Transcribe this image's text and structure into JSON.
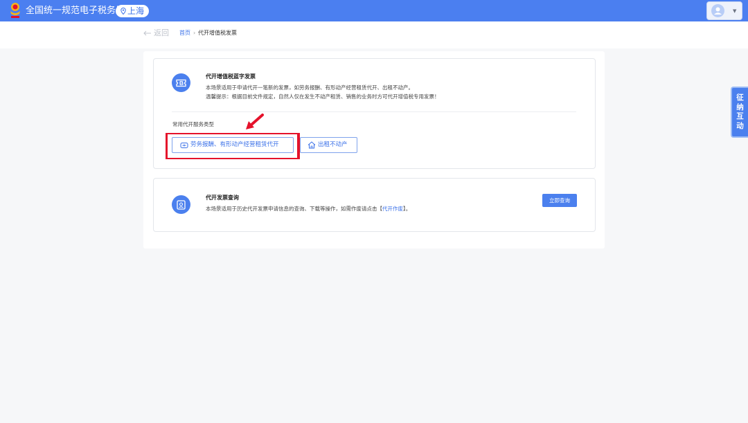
{
  "header": {
    "title": "全国统一规范电子税务局",
    "city": "上海"
  },
  "breadcrumb": {
    "back": "返回",
    "home": "首页",
    "separator": "›",
    "current": "代开增值税发票"
  },
  "cards": [
    {
      "title": "代开增值税蓝字发票",
      "desc_lines": [
        "本场景适用于申请代开一笔新的发票，如劳务报酬、有形动产经营租赁代开、出租不动产。",
        "温馨提示：根据目前文件规定，自然人仅在发生不动产租赁、销售的业务时方可代开增值税专用发票！"
      ],
      "section_label": "常用代开服务类型",
      "services": [
        {
          "label": "劳务报酬、有形动产经营租赁代开",
          "icon": "service-icon"
        },
        {
          "label": "出租不动产",
          "icon": "house-icon"
        }
      ]
    },
    {
      "title": "代开发票查询",
      "desc_prefix": "本场景适用于历史代开发票申请信息的查询、下载等操作，如需作废请点击【",
      "desc_link": "代开作废",
      "desc_suffix": "】。",
      "button": "立即查询"
    }
  ],
  "side_tab": [
    "征",
    "纳",
    "互",
    "动"
  ],
  "colors": {
    "primary": "#4b7ff0",
    "link": "#3a70e8",
    "highlight": "#e5122b"
  }
}
